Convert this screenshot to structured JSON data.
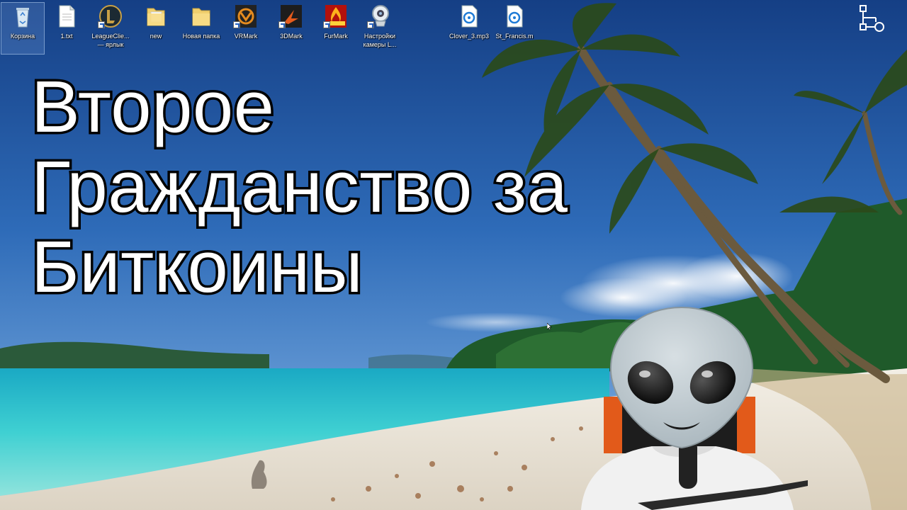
{
  "desktop": {
    "icons": [
      {
        "label": "Корзина",
        "icon": "recycle-bin-icon"
      },
      {
        "label": "1.txt",
        "icon": "text-file-icon"
      },
      {
        "label": "LeagueClie... — ярлык",
        "icon": "league-of-legends-icon"
      },
      {
        "label": "new",
        "icon": "folder-icon"
      },
      {
        "label": "Новая папка",
        "icon": "folder-icon"
      },
      {
        "label": "VRMark",
        "icon": "vrmark-icon"
      },
      {
        "label": "3DMark",
        "icon": "3dmark-icon"
      },
      {
        "label": "FurMark",
        "icon": "furmark-icon"
      },
      {
        "label": "Настройки камеры L...",
        "icon": "webcam-settings-icon"
      },
      {
        "label": "Clover_3.mp3",
        "icon": "audio-file-icon"
      },
      {
        "label": "St_Francis.m",
        "icon": "audio-file-icon"
      }
    ]
  },
  "overlay": {
    "headline_lines": [
      "Второе",
      "Гражданство за",
      "Биткоины"
    ],
    "emoji": "alien-emoji"
  },
  "colors": {
    "sky_top": "#1b4e96",
    "sky_mid": "#3a7bc8",
    "sea": "#27c2c8",
    "sand": "#ece7dc",
    "headline_text": "#ffffff",
    "headline_outline": "#000000"
  }
}
